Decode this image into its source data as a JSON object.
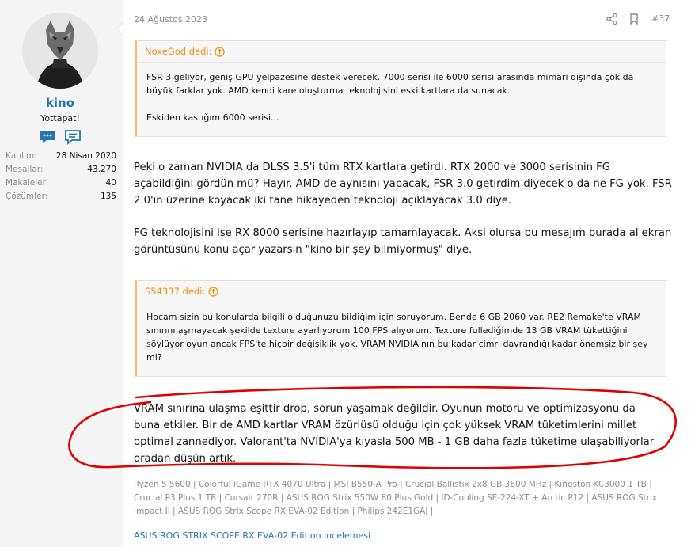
{
  "user": {
    "name": "kino",
    "title": "Yottapat!",
    "stats": [
      {
        "label": "Katılım:",
        "value": "28 Nisan 2020"
      },
      {
        "label": "Mesajlar:",
        "value": "43.270"
      },
      {
        "label": "Makaleler:",
        "value": "40"
      },
      {
        "label": "Çözümler:",
        "value": "135"
      }
    ]
  },
  "message": {
    "date": "24 Ağustos 2023",
    "number": "#37",
    "quote1": {
      "author": "NoxeGod dedi:",
      "text1": "FSR 3 geliyor, geniş GPU yelpazesine destek verecek. 7000 serisi ile 6000 serisi arasında mimari dışında çok da büyük farklar yok. AMD kendi kare oluşturma teknolojisini eski kartlara da sunacak.",
      "text2": "Eskiden kastığım 6000 serisi..."
    },
    "paragraph1": "Peki o zaman NVIDIA da DLSS 3.5'i tüm RTX kartlara getirdi. RTX 2000 ve 3000 serisinin FG açabildiğini gördün mü? Hayır. AMD de aynısını yapacak, FSR 3.0 getirdim diyecek o da ne FG yok. FSR 2.0'ın üzerine koyacak iki tane hikayeden teknoloji açıklayacak 3.0 diye.",
    "paragraph2": "FG teknolojisini ise RX 8000 serisine hazırlayıp tamamlayacak. Aksi olursa bu mesajım burada al ekran görüntüsünü konu açar yazarsın \"kino bir şey bilmiyormuş\" diye.",
    "quote2": {
      "author": "S54337 dedi:",
      "text": "Hocam sizin bu konularda bilgili olduğunuzu bildiğim için soruyorum. Bende 6 GB 2060 var. RE2 Remake'te VRAM sınırını aşmayacak şekilde texture ayarlıyorum 100 FPS alıyorum. Texture fullediğimde 13 GB VRAM tükettiğini söylüyor oyun ancak FPS'te hiçbir değişiklik yok. VRAM NVIDIA'nın bu kadar cimri davrandığı kadar önemsiz bir şey mi?"
    },
    "paragraph3": "VRAM sınırına ulaşma eşittir drop, sorun yaşamak değildir. Oyunun motoru ve optimizasyonu da buna etkiler. Bir de AMD kartlar VRAM özürlüsü olduğu için çok yüksek VRAM tüketimlerini millet optimal zannediyor. Valorant'ta NVIDIA'ya kıyasla 500 MB - 1 GB daha fazla tüketime ulaşabiliyorlar oradan düşün artık.",
    "signature": "Ryzen 5 5600 | Colorful iGame RTX 4070 Ultra | MSI B550-A Pro | Crucial Ballistix 2x8 GB 3600 MHz | Kingston KC3000 1 TB | Crucial P3 Plus 1 TB | Corsair 270R | ASUS ROG Strix 550W 80 Plus Gold | ID-Cooling SE-224-XT + Arctic P12 | ASUS ROG Strix Impact II | ASUS ROG Strix Scope RX EVA-02 Edition | Philips 242E1GAJ |",
    "signature_link": "ASUS ROG STRIX SCOPE RX EVA-02 Edition incelemesi"
  },
  "colors": {
    "accent": "#2577b1",
    "quote_accent": "#ef8d11",
    "annotation": "#e00000"
  },
  "icons": [
    "share-icon",
    "bookmark-icon",
    "arrow-circle-up-icon",
    "conversation-icon",
    "profile-icon"
  ]
}
